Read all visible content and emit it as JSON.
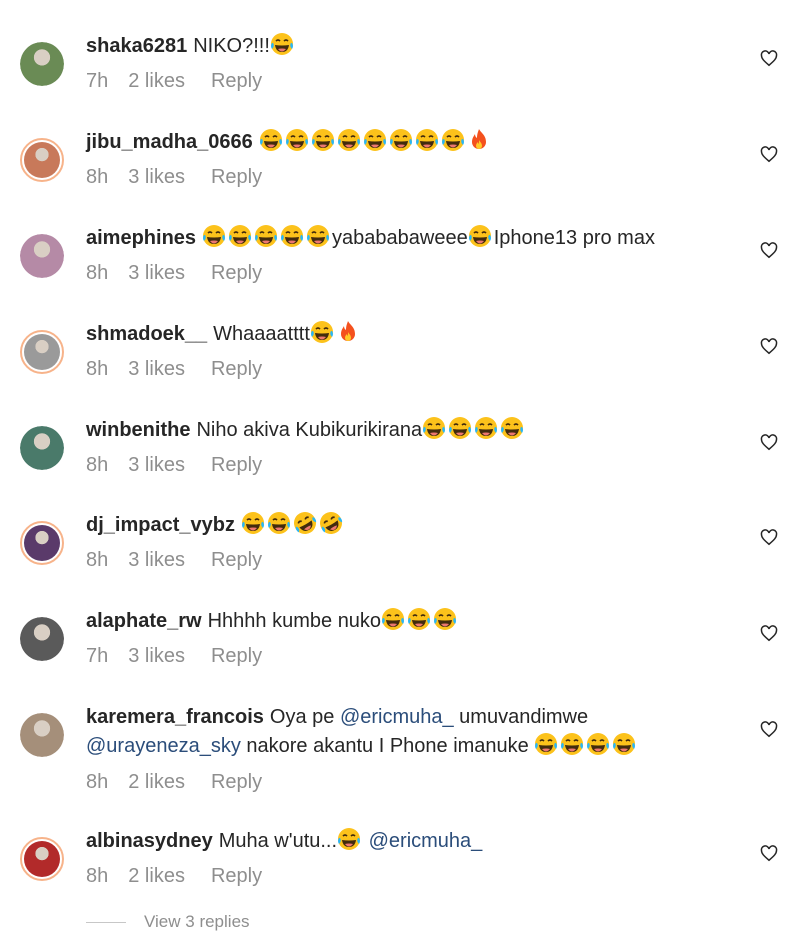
{
  "comments": [
    {
      "username": "shaka6281",
      "text": "NIKO?!!!",
      "emoji_after": [
        "laugh-cry"
      ],
      "time": "7h",
      "likes": "2 likes",
      "reply": "Reply",
      "avatar_color": "#6a8b55",
      "ring": false
    },
    {
      "username": "jibu_madha_0666",
      "text": "",
      "emoji_after": [
        "laugh-cry",
        "laugh-cry",
        "laugh-cry",
        "laugh-cry",
        "laugh-cry",
        "laugh-cry",
        "laugh-cry",
        "laugh-cry",
        "fire"
      ],
      "time": "8h",
      "likes": "3 likes",
      "reply": "Reply",
      "avatar_color": "#c8795a",
      "ring": true
    },
    {
      "username": "aimephines",
      "text": "",
      "emoji_after": [
        "laugh-cry",
        "laugh-cry",
        "laugh-cry",
        "laugh-cry",
        "laugh-cry"
      ],
      "text2": "yabababaweee",
      "emoji_after2": [
        "laugh-cry"
      ],
      "text3": "Iphone13 pro max",
      "time": "8h",
      "likes": "3 likes",
      "reply": "Reply",
      "avatar_color": "#b58aa6",
      "ring": false
    },
    {
      "username": "shmadoek__",
      "text": "Whaaaatttt",
      "emoji_after": [
        "laugh-cry",
        "fire"
      ],
      "time": "8h",
      "likes": "3 likes",
      "reply": "Reply",
      "avatar_color": "#9a9a9a",
      "ring": true
    },
    {
      "username": "winbenithe",
      "text": "Niho akiva Kubikurikirana",
      "emoji_after": [
        "laugh-cry",
        "laugh-cry",
        "laugh-cry",
        "laugh-cry"
      ],
      "time": "8h",
      "likes": "3 likes",
      "reply": "Reply",
      "avatar_color": "#4a7a6a",
      "ring": false
    },
    {
      "username": "dj_impact_vybz",
      "text": "",
      "emoji_after": [
        "laugh-cry",
        "laugh-cry",
        "rofl",
        "rofl"
      ],
      "time": "8h",
      "likes": "3 likes",
      "reply": "Reply",
      "avatar_color": "#5a3a6a",
      "ring": true
    },
    {
      "username": "alaphate_rw",
      "text": "Hhhhh kumbe nuko",
      "emoji_after": [
        "laugh-cry",
        "laugh-cry",
        "laugh-cry"
      ],
      "time": "7h",
      "likes": "3 likes",
      "reply": "Reply",
      "avatar_color": "#5a5a5a",
      "ring": false
    },
    {
      "username": "karemera_francois",
      "text": "Oya pe",
      "mention1": "@ericmuha_",
      "text_b": "umuvandimwe",
      "mention2": "@urayeneza_sky",
      "text_c": "nakore akantu I Phone imanuke",
      "emoji_after": [
        "laugh-cry",
        "laugh-cry",
        "laugh-cry",
        "laugh-cry"
      ],
      "time": "8h",
      "likes": "2 likes",
      "reply": "Reply",
      "avatar_color": "#a58f7a",
      "ring": false
    },
    {
      "username": "albinasydney",
      "text": "Muha w'utu...",
      "emoji_after": [
        "laugh-cry"
      ],
      "mention1": "@ericmuha_",
      "time": "8h",
      "likes": "2 likes",
      "reply": "Reply",
      "avatar_color": "#b22a2a",
      "ring": true
    }
  ],
  "view_replies": "View 3 replies",
  "colors": {
    "meta": "#8e8e8e",
    "mention": "#2b4d7a",
    "ring": "#f7b38a"
  }
}
